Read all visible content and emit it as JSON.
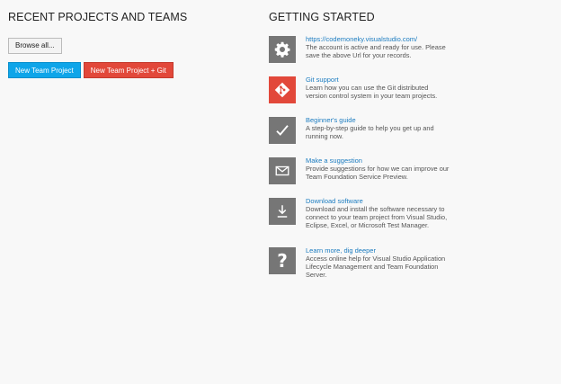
{
  "recent": {
    "heading": "RECENT PROJECTS AND TEAMS",
    "browse_label": "Browse all...",
    "new_project_label": "New Team Project",
    "new_project_git_label": "New Team Project + Git"
  },
  "getting_started": {
    "heading": "GETTING STARTED",
    "items": [
      {
        "icon": "gear-icon",
        "title": "https://codemoneky.visualstudio.com/",
        "desc": "The account is active and ready for use. Please save the above Url for your records."
      },
      {
        "icon": "git-icon",
        "title": "Git support",
        "desc": "Learn how you can use the Git distributed version control system in your team projects."
      },
      {
        "icon": "checkmark-icon",
        "title": "Beginner's guide",
        "desc": "A step-by-step guide to help you get up and running now."
      },
      {
        "icon": "envelope-icon",
        "title": "Make a suggestion",
        "desc": "Provide suggestions for how we can improve our Team Foundation Service Preview."
      },
      {
        "icon": "download-icon",
        "title": "Download software",
        "desc": "Download and install the software necessary to connect to your team project from Visual Studio, Eclipse, Excel, or Microsoft Test Manager."
      },
      {
        "icon": "question-icon",
        "title": "Learn more, dig deeper",
        "desc": "Access online help for Visual Studio Application Lifecycle Management and Team Foundation Server."
      }
    ]
  }
}
